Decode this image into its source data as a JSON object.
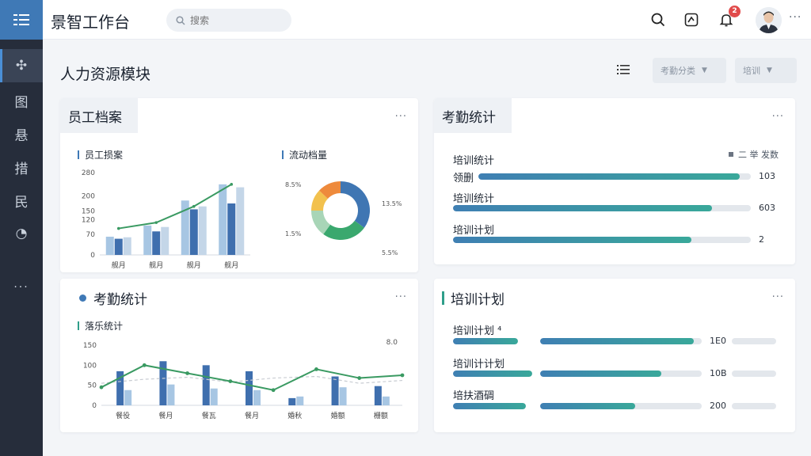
{
  "app": {
    "title": "景智工作台"
  },
  "search": {
    "placeholder": "搜索"
  },
  "topbar": {
    "badge_count": "2"
  },
  "sidebar": {
    "items": [
      {
        "glyph": "☷",
        "icon": "apps-grid-icon"
      },
      {
        "glyph": "✣",
        "icon": "dashboard-icon"
      },
      {
        "glyph": "图",
        "icon": "chart-icon"
      },
      {
        "glyph": "悬",
        "icon": "list-icon"
      },
      {
        "glyph": "措",
        "icon": "calendar-icon"
      },
      {
        "glyph": "民",
        "icon": "people-icon"
      },
      {
        "glyph": "◔",
        "icon": "clock-icon"
      },
      {
        "glyph": "⋮",
        "icon": "more-icon"
      }
    ]
  },
  "page": {
    "title": "人力资源模块",
    "filter1": "考勤分类",
    "filter2": "培训"
  },
  "card_archive": {
    "tab": "员工档案",
    "bar_title": "员工损案",
    "donut_title": "流动档量"
  },
  "card_attendance_stats": {
    "tab": "考勤统计",
    "legend": "二 举 发数",
    "items": [
      {
        "label": "培训统计",
        "value": ""
      },
      {
        "label": "领删",
        "value": "103"
      },
      {
        "label": "培训统计",
        "value": "603"
      },
      {
        "label": "培训计划",
        "value": "2"
      }
    ]
  },
  "card_attendance_chart": {
    "title": "考勤统计",
    "sub_title": "落乐统计"
  },
  "card_training": {
    "title": "培训计划",
    "items": [
      {
        "label": "培训计划 ⁴",
        "value": "1E0"
      },
      {
        "label": "培训计计划",
        "value": "10B"
      },
      {
        "label": "培扶酒碉",
        "value": "200"
      }
    ]
  },
  "chart_data": [
    {
      "type": "bar",
      "title": "员工损案",
      "categories": [
        "舰月",
        "舰月",
        "舰月",
        "舰月"
      ],
      "ylim": [
        0,
        280
      ],
      "yticks": [
        0,
        70,
        120,
        150,
        200,
        280
      ],
      "series": [
        {
          "values": [
            62,
            100,
            185,
            240
          ]
        },
        {
          "values": [
            55,
            80,
            155,
            175
          ]
        },
        {
          "values": [
            60,
            95,
            165,
            230
          ]
        }
      ],
      "line": [
        90,
        110,
        165,
        240
      ],
      "colors": [
        "#a7c6e3",
        "#3f6fae",
        "#c4d6e8",
        "#3a9a62"
      ],
      "grid": false
    },
    {
      "type": "pie",
      "title": "流动档量",
      "values": [
        35,
        25,
        15,
        12,
        13
      ],
      "labels": [
        "13.5%",
        "5.5%",
        "8.5%",
        "1.5%"
      ],
      "colors": [
        "#3f76b3",
        "#3aa86e",
        "#a8d5b7",
        "#f2c14e",
        "#ee8a3c"
      ]
    },
    {
      "type": "bar",
      "title": "落乐统计",
      "categories": [
        "餐役",
        "餐月",
        "餐瓦",
        "餐月",
        "婚秋",
        "婚额",
        "栅额"
      ],
      "ylim": [
        0,
        150
      ],
      "yticks": [
        0,
        50,
        100,
        150
      ],
      "series": [
        {
          "values": [
            85,
            110,
            100,
            85,
            18,
            72,
            48
          ]
        },
        {
          "values": [
            38,
            52,
            42,
            38,
            22,
            45,
            22
          ]
        }
      ],
      "line": [
        45,
        100,
        80,
        60,
        38,
        90,
        68,
        75
      ],
      "line2": [
        55,
        65,
        70,
        58,
        68,
        72,
        55,
        62
      ],
      "annotation": "8.0",
      "colors": [
        "#3f6fae",
        "#a7c6e3",
        "#3a9a62",
        "#c8ccd2"
      ],
      "grid": false
    }
  ]
}
